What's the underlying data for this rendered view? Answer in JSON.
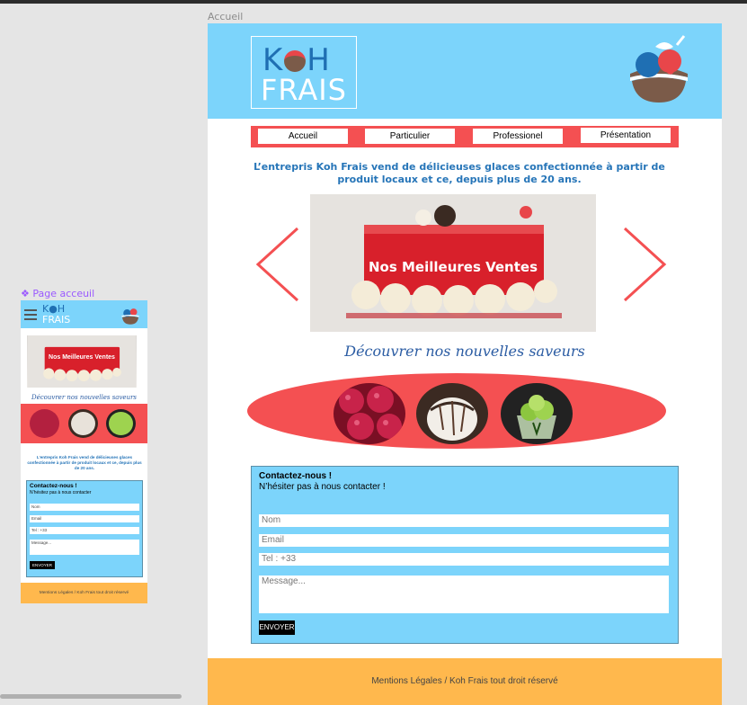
{
  "frames": {
    "desktop_label": "Accueil",
    "mobile_label": "❖ Page acceuil"
  },
  "colors": {
    "header_blue": "#7cd4fb",
    "accent_red": "#f45052",
    "footer_orange": "#ffb84d",
    "brand_blue": "#2675b8"
  },
  "logo": {
    "line1_left": "K",
    "line1_right": "H",
    "line2": "FRAIS",
    "icon": "ice-cream-bowl-icon"
  },
  "nav": {
    "items": [
      {
        "label": "Accueil"
      },
      {
        "label": "Particulier"
      },
      {
        "label": "Professionel"
      },
      {
        "label": "Présentation"
      }
    ]
  },
  "intro": "L’entrepris Koh Frais vend de délicieuses glaces confectionnée à partir de produit locaux et ce, depuis plus de 20 ans.",
  "carousel": {
    "title": "Nos Meilleures Ventes",
    "prev_icon": "chevron-left-icon",
    "next_icon": "chevron-right-icon"
  },
  "discover": "Découvrer nos nouvelles saveurs",
  "flavors": [
    {
      "icon": "raspberry-icon"
    },
    {
      "icon": "chocolate-cream-icon"
    },
    {
      "icon": "matcha-sundae-icon"
    }
  ],
  "contact": {
    "title": "Contactez-nous !",
    "subtitle": "N’hésiter pas à nous contacter !",
    "name_placeholder": "Nom",
    "email_placeholder": "Email",
    "tel_placeholder": "Tel : +33",
    "message_placeholder": "Message...",
    "send_label": "ENVOYER"
  },
  "footer": "Mentions Légales / Koh Frais tout droit réservé",
  "mobile": {
    "intro": "L’entrepris Koh Frais vend de délicieuses glaces confectionnée à partir de produit locaux et ce, depuis plus de 20 ans.",
    "contact_subtitle": "N’hésitez pas à nous contacter",
    "tel_placeholder": "Tel : +33",
    "footer": "Mentions Légales / Koh Frais tout droit réservé"
  }
}
